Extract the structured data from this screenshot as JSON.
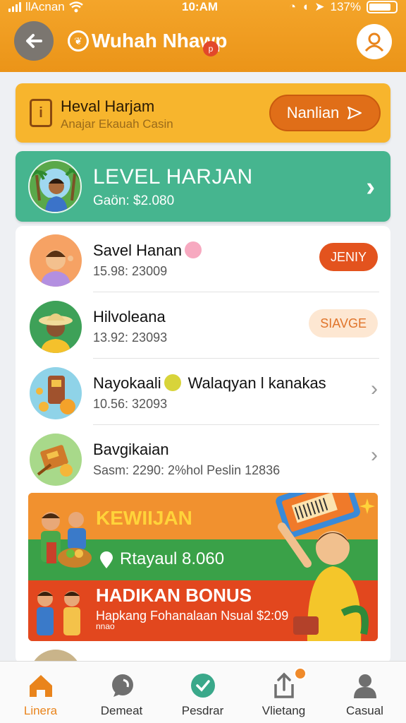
{
  "status_bar": {
    "carrier": "llAcnan",
    "time": "10:AM",
    "battery": "137%"
  },
  "header": {
    "title": "Wuhah Nhawp",
    "badge": "p"
  },
  "promo_card": {
    "title": "Heval Harjam",
    "subtitle": "Anajar Ekauah Casin",
    "button_label": "Nanlian"
  },
  "level_card": {
    "title": "LEVEL HARJAN",
    "subtitle": "Gaön: $2.080"
  },
  "list": {
    "items": [
      {
        "title": "Savel Hanan",
        "subtitle": "15.98: 23009",
        "pill": "JENIY",
        "pill_style": "red"
      },
      {
        "title": "Hilvoleana",
        "subtitle": "13.92: 23093",
        "pill": "SIAVGE",
        "pill_style": "peach"
      },
      {
        "title": "Nayokaali",
        "title_extra": "Walaqyan l kanakas",
        "subtitle": "10.56: 32093",
        "chevron": true
      },
      {
        "title": "Bavgikaian",
        "subtitle": "Sasm: 2290: 2%hol Peslin 12836",
        "chevron": true
      }
    ]
  },
  "banner": {
    "title": "KEWIIJAN",
    "mid_text": "Rtayaul 8.060",
    "bonus_title": "HADIKAN BONUS",
    "detail": "Hapkang Fohanalaan Nsual $2:09",
    "amount": "nnao"
  },
  "bottom_nav": {
    "items": [
      {
        "label": "Linera",
        "icon": "home-icon",
        "active": true
      },
      {
        "label": "Demeat",
        "icon": "chat-icon",
        "active": false
      },
      {
        "label": "Pesdrar",
        "icon": "check-icon",
        "active": false
      },
      {
        "label": "Vlietang",
        "icon": "share-icon",
        "active": false,
        "badge": true
      },
      {
        "label": "Casual",
        "icon": "profile-icon",
        "active": false
      }
    ]
  },
  "colors": {
    "header": "#eb9418",
    "promo": "#f7b52d",
    "level": "#46b58f",
    "accent": "#e3531e"
  }
}
